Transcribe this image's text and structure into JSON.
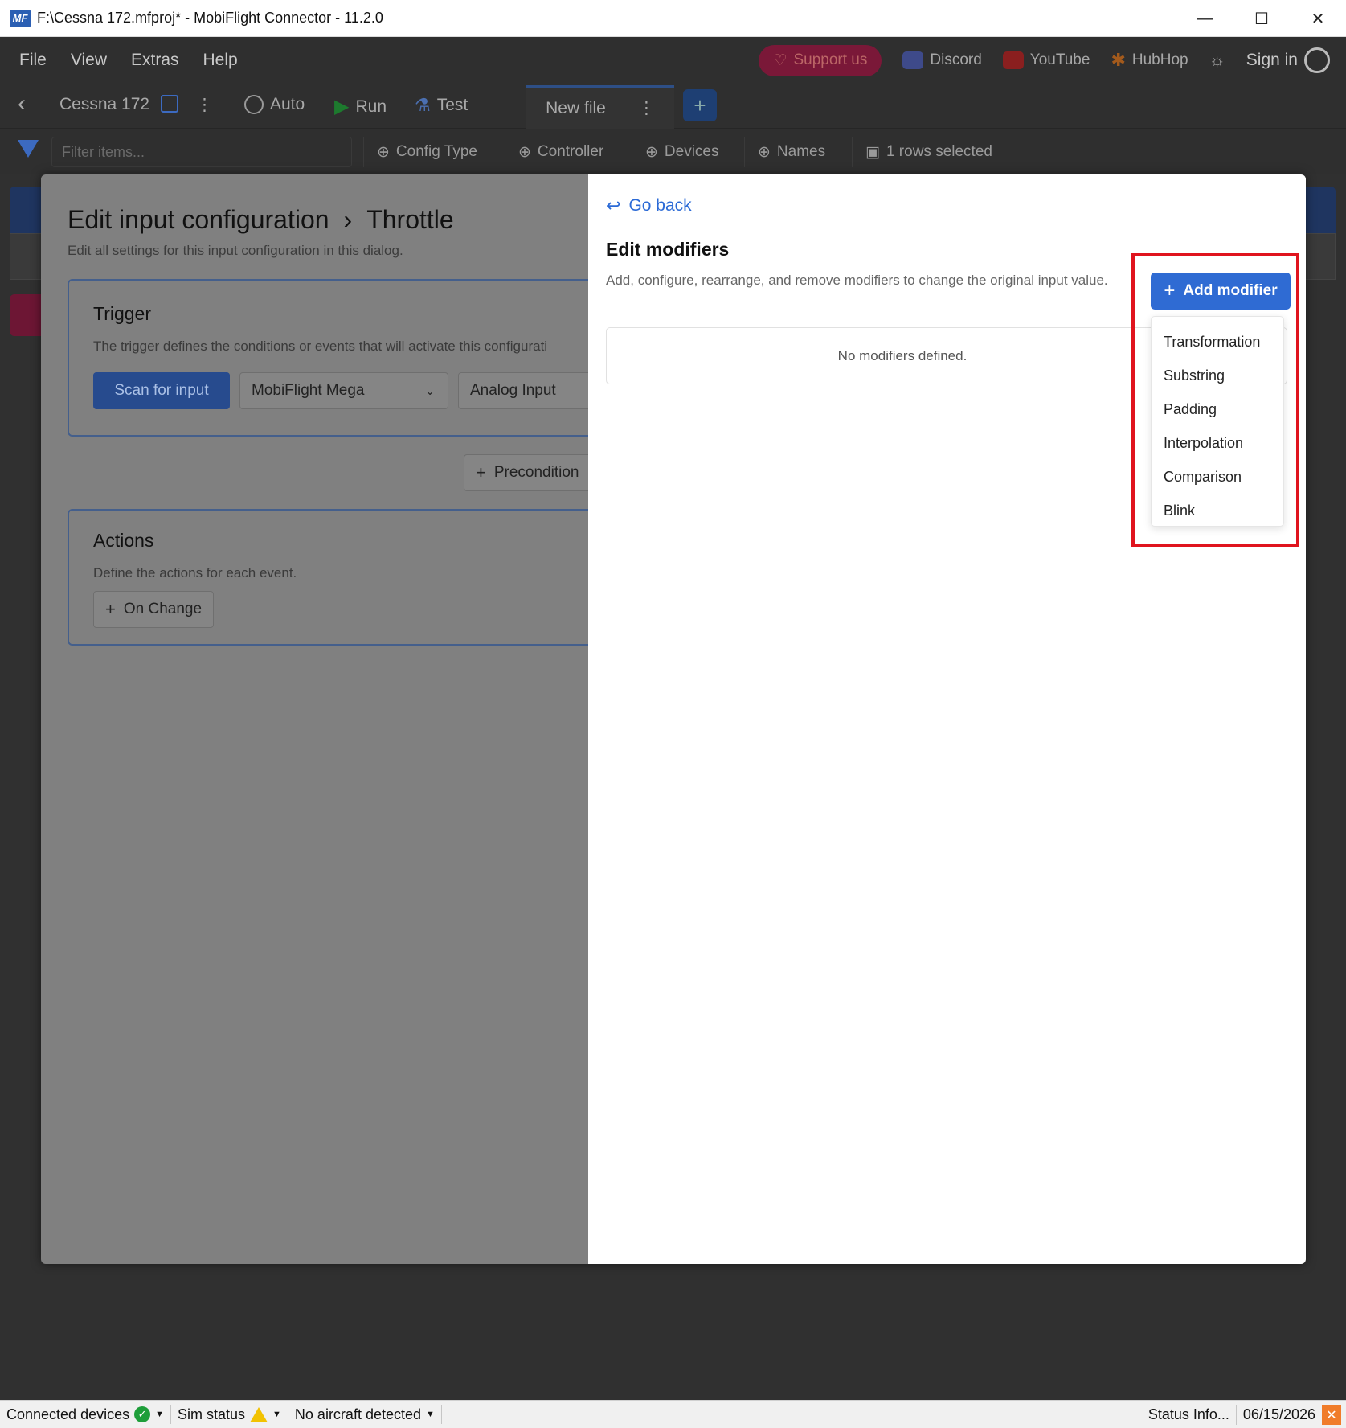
{
  "window": {
    "title": "F:\\Cessna 172.mfproj* - MobiFlight Connector - 11.2.0",
    "logo_text": "MF",
    "minimize": "—",
    "maximize": "☐",
    "close": "✕"
  },
  "menu": {
    "items": [
      "File",
      "View",
      "Extras",
      "Help"
    ],
    "support": "Support us",
    "discord": "Discord",
    "youtube": "YouTube",
    "hubhop": "HubHop",
    "sign_in": "Sign in"
  },
  "toolbar": {
    "back": "‹",
    "project_name": "Cessna 172",
    "auto": "Auto",
    "run": "Run",
    "test": "Test",
    "tab_label": "New file",
    "tab_menu": "⋮",
    "add_tab": "+"
  },
  "filterbar": {
    "placeholder": "Filter items...",
    "chips": [
      "Config Type",
      "Controller",
      "Devices",
      "Names"
    ],
    "rows_selected": "1 rows selected"
  },
  "modal_left": {
    "title": "Edit input configuration",
    "separator": "›",
    "breadcrumb_item": "Throttle",
    "subtitle": "Edit all settings for this input configuration in this dialog.",
    "trigger": {
      "title": "Trigger",
      "description": "The trigger defines the conditions or events that will activate this configurati",
      "scan_button": "Scan for input",
      "controller_value": "MobiFlight Mega",
      "device_value": "Analog Input"
    },
    "precondition_button": "Precondition",
    "actions": {
      "title": "Actions",
      "description": "Define the actions for each event.",
      "on_change_button": "On Change"
    }
  },
  "modal_right": {
    "go_back": "Go back",
    "title": "Edit modifiers",
    "description": "Add, configure, rearrange, and remove modifiers to change the original input value.",
    "empty_text": "No modifiers defined.",
    "add_button": "Add modifier",
    "dropdown_items": [
      "Transformation",
      "Substring",
      "Padding",
      "Interpolation",
      "Comparison",
      "Blink"
    ]
  },
  "statusbar": {
    "connected_devices": "Connected devices",
    "sim_status": "Sim status",
    "aircraft": "No aircraft detected",
    "status_info": "Status Info...",
    "date": "06/15/2026"
  },
  "colors": {
    "accent": "#2f6bd3",
    "highlight": "#e0141e",
    "success": "#1e9e3a",
    "warning": "#f2c200"
  }
}
